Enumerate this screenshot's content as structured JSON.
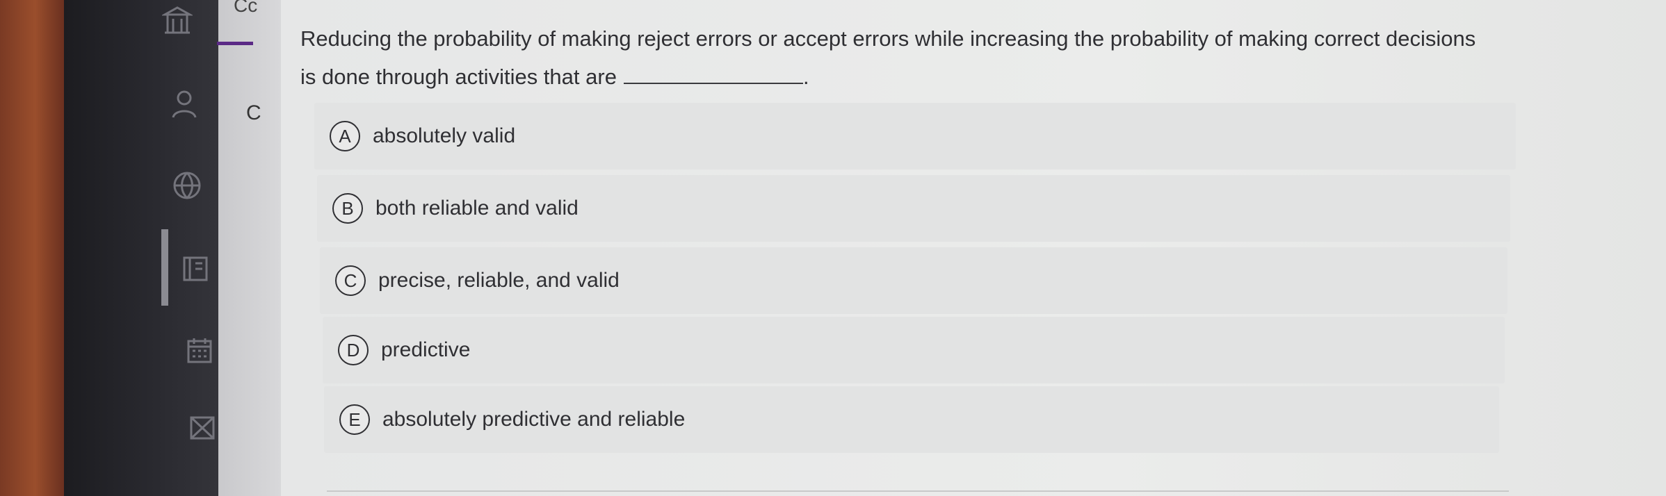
{
  "panel": {
    "top_text": "Cc",
    "mid_text": "C"
  },
  "question": {
    "text": "Reducing the probability of making reject errors or accept errors while increasing the probability of making correct decisions is done through activities that are",
    "end_punct": "."
  },
  "options": [
    {
      "letter": "A",
      "text": "absolutely valid"
    },
    {
      "letter": "B",
      "text": "both reliable and valid"
    },
    {
      "letter": "C",
      "text": "precise, reliable, and valid"
    },
    {
      "letter": "D",
      "text": "predictive"
    },
    {
      "letter": "E",
      "text": "absolutely predictive and reliable"
    }
  ],
  "icons": [
    "building-icon",
    "person-icon",
    "globe-icon",
    "book-icon",
    "calendar-icon",
    "mail-icon"
  ]
}
